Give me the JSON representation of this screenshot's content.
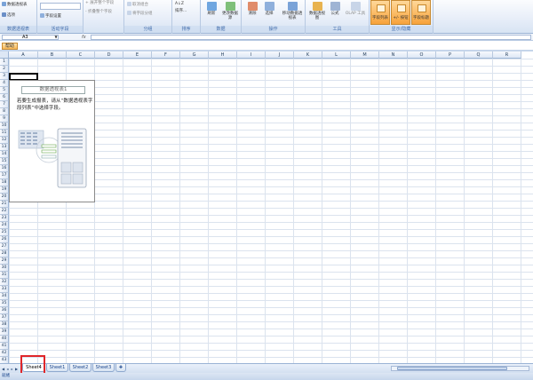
{
  "ribbon": {
    "groups": [
      {
        "name": "pivot-table",
        "label": "数据透视表",
        "buttons": [
          "数据透视表",
          "选项"
        ]
      },
      {
        "name": "active-field",
        "label": "活动字段",
        "buttons": [
          "字段设置"
        ]
      },
      {
        "name": "group",
        "label": "分组",
        "buttons": [
          "将所选内容分组",
          "取消组合",
          "将字段分组"
        ]
      },
      {
        "name": "sort",
        "label": "排序",
        "buttons": [
          "排序..."
        ]
      },
      {
        "name": "data",
        "label": "数据",
        "buttons": [
          "刷新",
          "更改数据源"
        ]
      },
      {
        "name": "actions",
        "label": "操作",
        "buttons": [
          "清除",
          "选择",
          "移动数据透视表"
        ]
      },
      {
        "name": "tools",
        "label": "工具",
        "buttons": [
          "数据透视图",
          "公式",
          "OLAP 工具"
        ]
      },
      {
        "name": "show-hide",
        "label": "显示/隐藏",
        "buttons": [
          "字段列表",
          "+/- 按钮",
          "字段标题"
        ]
      }
    ],
    "doc_badge": "帮助"
  },
  "formula_bar": {
    "name_box": "A3",
    "fx": "fx",
    "value": ""
  },
  "columns": [
    "A",
    "B",
    "C",
    "D",
    "E",
    "F",
    "G",
    "H",
    "I",
    "J",
    "K",
    "L",
    "M",
    "N",
    "O",
    "P",
    "Q",
    "R"
  ],
  "rows": [
    "1",
    "2",
    "3",
    "4",
    "5",
    "6",
    "7",
    "8",
    "9",
    "10",
    "11",
    "12",
    "13",
    "14",
    "15",
    "16",
    "17",
    "18",
    "19",
    "20",
    "21",
    "22",
    "23",
    "24",
    "25",
    "26",
    "27",
    "28",
    "29",
    "30",
    "31",
    "32",
    "33",
    "34",
    "35",
    "36",
    "37",
    "38",
    "39",
    "40",
    "41",
    "42",
    "43"
  ],
  "pivot": {
    "title": "数据透视表1",
    "hint": "若要生成报表，请从“数据透视表字段列表”中选择字段。"
  },
  "sheets": {
    "tabs": [
      "Sheet4",
      "Sheet1",
      "Sheet2",
      "Sheet3"
    ],
    "active": "Sheet4"
  },
  "status": {
    "text": "就绪"
  },
  "colors": {
    "highlight": "#e0262a",
    "ribbon_accent": "#f7a23a"
  }
}
